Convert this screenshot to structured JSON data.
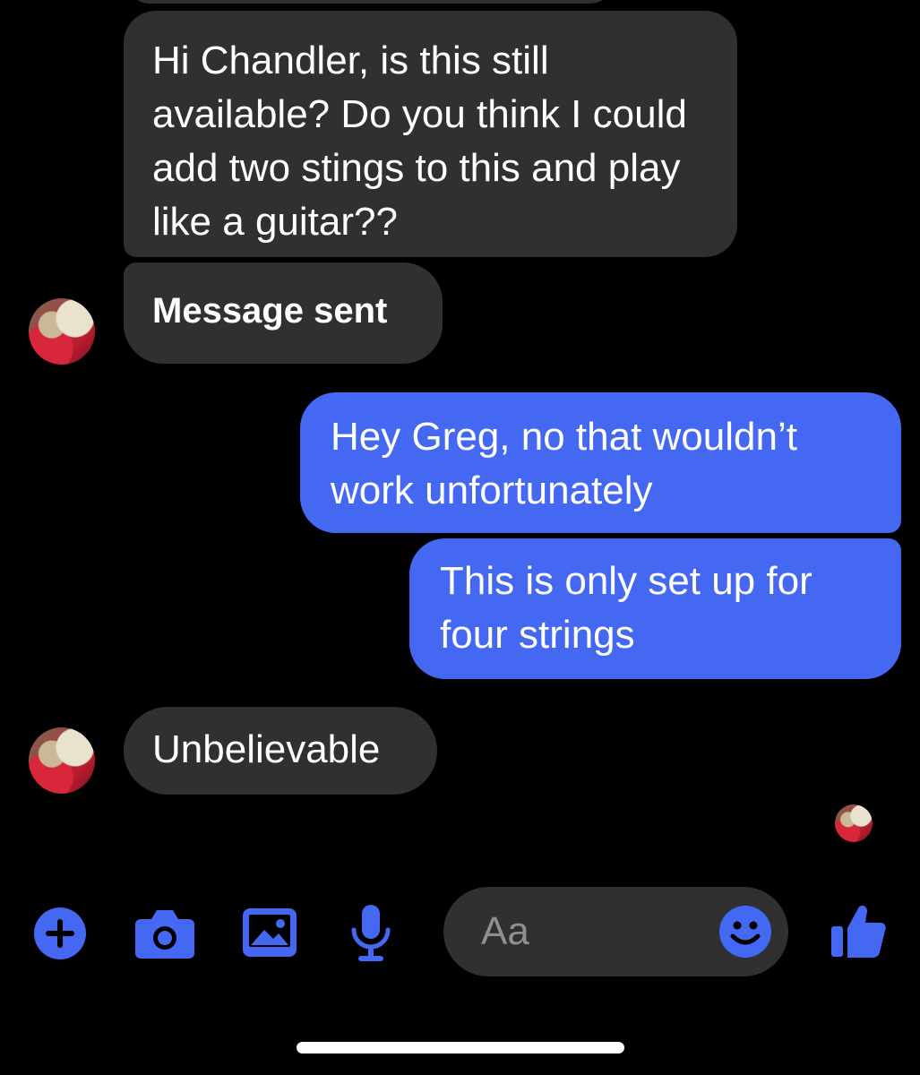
{
  "messages": [
    {
      "text": "Hi Chandler, is this still available? Do you think I could add two stings to this and play like a guitar??"
    },
    {
      "text": "Message sent"
    },
    {
      "text": "Hey Greg, no that wouldn’t work unfortunately"
    },
    {
      "text": "This is only set up for four strings"
    },
    {
      "text": "Unbelievable"
    }
  ],
  "composer": {
    "placeholder": "Aa",
    "icons": [
      "plus-icon",
      "camera-icon",
      "image-icon",
      "microphone-icon",
      "emoji-icon",
      "thumbs-up-icon"
    ],
    "accent_color": "#4568f3"
  },
  "colors": {
    "incoming_bubble": "#303030",
    "outgoing_bubble": "#4568f3",
    "background": "#000000"
  }
}
